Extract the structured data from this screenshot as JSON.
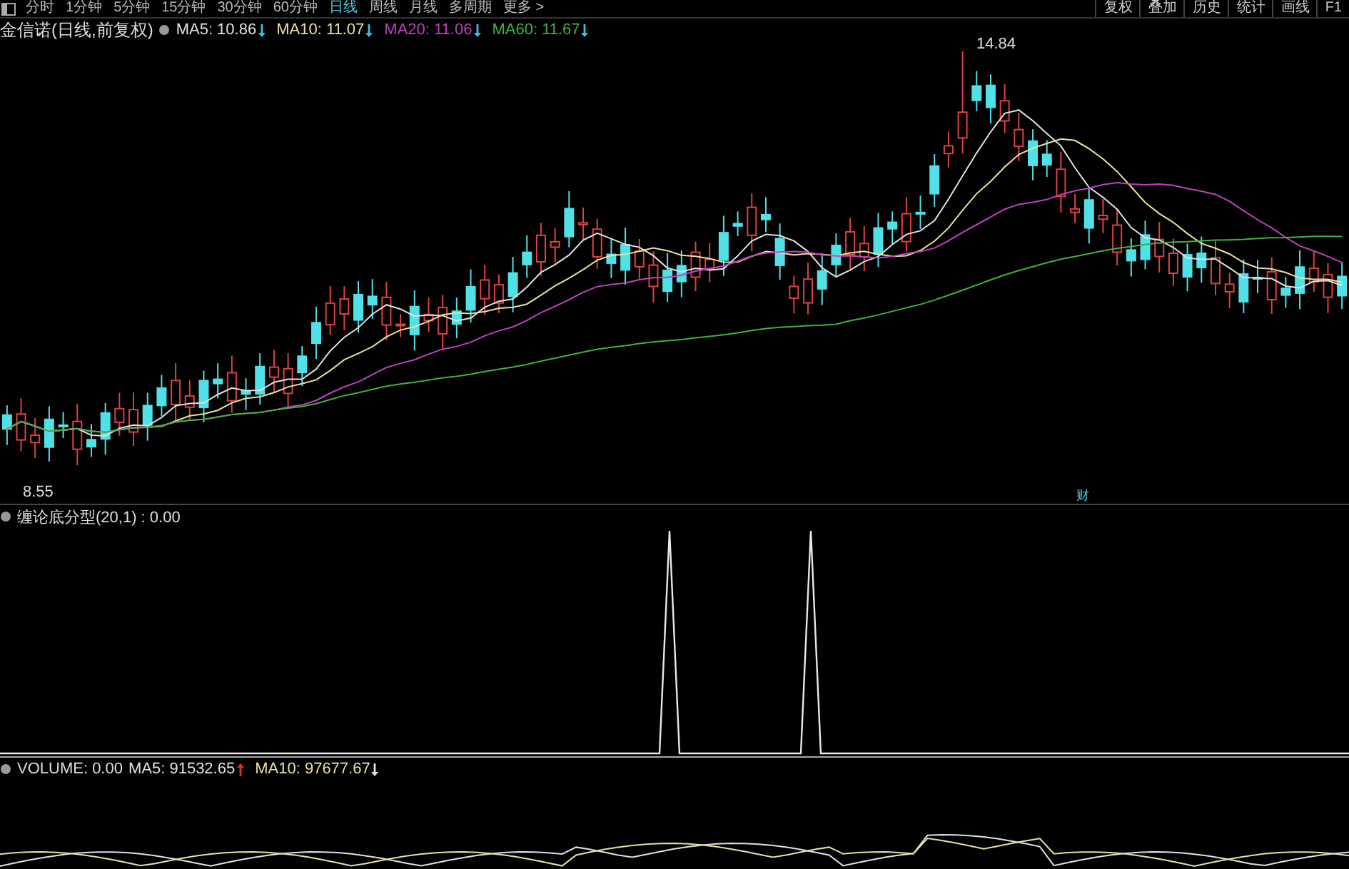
{
  "toolbar": {
    "periods": [
      {
        "label": "分时",
        "selected": false
      },
      {
        "label": "1分钟",
        "selected": false
      },
      {
        "label": "5分钟",
        "selected": false
      },
      {
        "label": "15分钟",
        "selected": false
      },
      {
        "label": "30分钟",
        "selected": false
      },
      {
        "label": "60分钟",
        "selected": false
      },
      {
        "label": "日线",
        "selected": true
      },
      {
        "label": "周线",
        "selected": false
      },
      {
        "label": "月线",
        "selected": false
      },
      {
        "label": "多周期",
        "selected": false
      },
      {
        "label": "更多 >",
        "selected": false
      }
    ],
    "buttons": [
      "复权",
      "叠加",
      "历史",
      "统计",
      "画线",
      "F1"
    ]
  },
  "main_panel": {
    "title": "金信诺(日线,前复权)",
    "indicators": [
      {
        "name": "MA5:",
        "value": "10.86",
        "rising": false,
        "color": "#e0e0e0"
      },
      {
        "name": "MA10:",
        "value": "11.07",
        "rising": false,
        "color": "#e8e0a0"
      },
      {
        "name": "MA20:",
        "value": "11.06",
        "rising": false,
        "color": "#c040c0"
      },
      {
        "name": "MA60:",
        "value": "11.67",
        "rising": false,
        "color": "#40b040"
      }
    ],
    "high_label": "14.84",
    "low_label": "8.55",
    "event_marker": "财"
  },
  "indicator_panel": {
    "legend": "缠论底分型(20,1) : 0.00"
  },
  "volume_panel": {
    "label": "VOLUME: 0.00",
    "indicators": [
      {
        "name": "MA5:",
        "value": "91532.65",
        "rising": true,
        "color": "#e0e0e0"
      },
      {
        "name": "MA10:",
        "value": "97677.67",
        "rising": false,
        "color": "#e8e0a0"
      }
    ]
  }
}
